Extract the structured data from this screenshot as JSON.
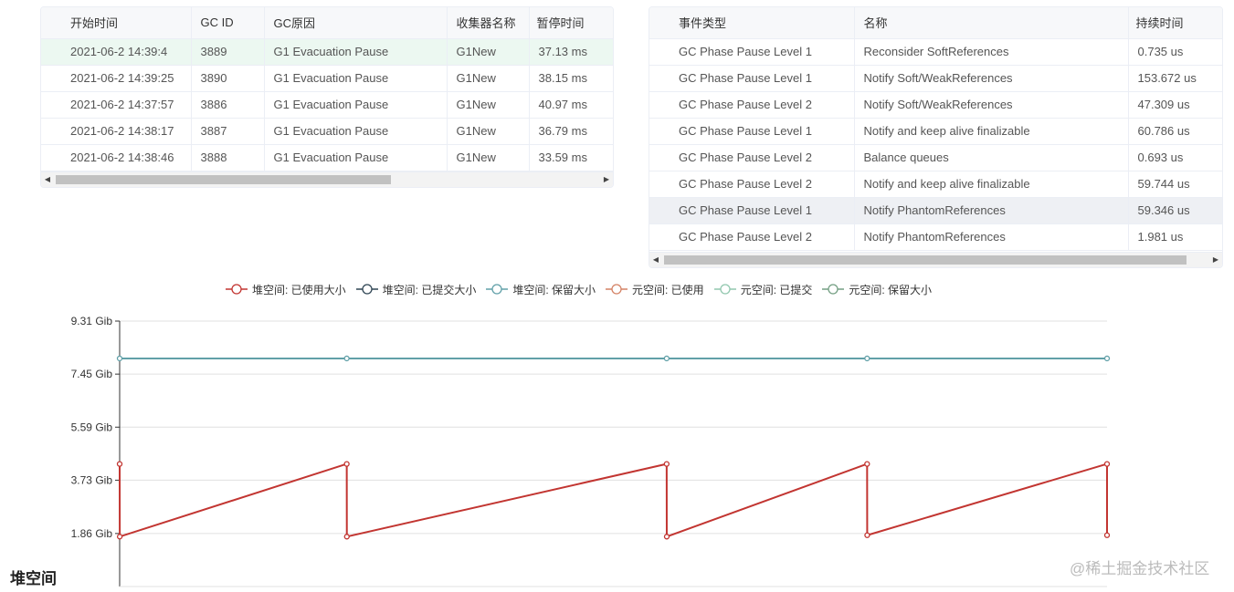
{
  "gc_table": {
    "columns": [
      "开始时间",
      "GC ID",
      "GC原因",
      "收集器名称",
      "暂停时间"
    ],
    "rows": [
      [
        "2021-06-2 14:39:4",
        "3889",
        "G1 Evacuation Pause",
        "G1New",
        "37.13 ms"
      ],
      [
        "2021-06-2 14:39:25",
        "3890",
        "G1 Evacuation Pause",
        "G1New",
        "38.15 ms"
      ],
      [
        "2021-06-2 14:37:57",
        "3886",
        "G1 Evacuation Pause",
        "G1New",
        "40.97 ms"
      ],
      [
        "2021-06-2 14:38:17",
        "3887",
        "G1 Evacuation Pause",
        "G1New",
        "36.79 ms"
      ],
      [
        "2021-06-2 14:38:46",
        "3888",
        "G1 Evacuation Pause",
        "G1New",
        "33.59 ms"
      ]
    ],
    "highlighted_row": 0,
    "scroll_arrow_left": "◀",
    "scroll_arrow_right": "▶"
  },
  "phase_table": {
    "columns": [
      "事件类型",
      "名称",
      "持续时间"
    ],
    "rows": [
      [
        "GC Phase Pause Level 1",
        "Reconsider SoftReferences",
        "0.735 us"
      ],
      [
        "GC Phase Pause Level 1",
        "Notify Soft/WeakReferences",
        "153.672 us"
      ],
      [
        "GC Phase Pause Level 2",
        "Notify Soft/WeakReferences",
        "47.309 us"
      ],
      [
        "GC Phase Pause Level 1",
        "Notify and keep alive finalizable",
        "60.786 us"
      ],
      [
        "GC Phase Pause Level 2",
        "Balance queues",
        "0.693 us"
      ],
      [
        "GC Phase Pause Level 2",
        "Notify and keep alive finalizable",
        "59.744 us"
      ],
      [
        "GC Phase Pause Level 1",
        "Notify PhantomReferences",
        "59.346 us"
      ],
      [
        "GC Phase Pause Level 2",
        "Notify PhantomReferences",
        "1.981 us"
      ]
    ],
    "hovered_row": 6,
    "scroll_arrow_left": "◀",
    "scroll_arrow_right": "▶"
  },
  "chart_section_title": "堆空间",
  "watermark": "@稀土掘金技术社区",
  "chart_data": {
    "type": "line",
    "title": "",
    "xlabel": "",
    "ylabel": "",
    "y_unit": "Gib",
    "y_ticks": [
      "1.86 Gib",
      "3.73 Gib",
      "5.59 Gib",
      "7.45 Gib",
      "9.31 Gib"
    ],
    "ylim": [
      0,
      9.31
    ],
    "grid": true,
    "legend_position": "top-center",
    "legend": [
      {
        "name": "堆空间: 已使用大小",
        "color": "#c23531"
      },
      {
        "name": "堆空间: 已提交大小",
        "color": "#2f4554"
      },
      {
        "name": "堆空间: 保留大小",
        "color": "#61a0a8"
      },
      {
        "name": "元空间: 已使用",
        "color": "#d48265"
      },
      {
        "name": "元空间: 已提交",
        "color": "#91c7ae"
      },
      {
        "name": "元空间: 保留大小",
        "color": "#749f83"
      }
    ],
    "x": [
      0,
      0.01,
      23.0,
      23.01,
      55.4,
      55.41,
      75.7,
      75.71,
      100
    ],
    "series": [
      {
        "name": "堆空间: 已使用大小",
        "color": "#c23531",
        "values": [
          4.3,
          1.75,
          4.3,
          1.75,
          4.3,
          1.75,
          4.3,
          1.8,
          4.3
        ],
        "tail": [
          1.8
        ]
      },
      {
        "name": "堆空间: 保留大小",
        "color": "#61a0a8",
        "points": [
          [
            0,
            8.0
          ],
          [
            23.0,
            8.0
          ],
          [
            55.4,
            8.0
          ],
          [
            75.7,
            8.0
          ],
          [
            100,
            8.0
          ]
        ]
      }
    ]
  }
}
